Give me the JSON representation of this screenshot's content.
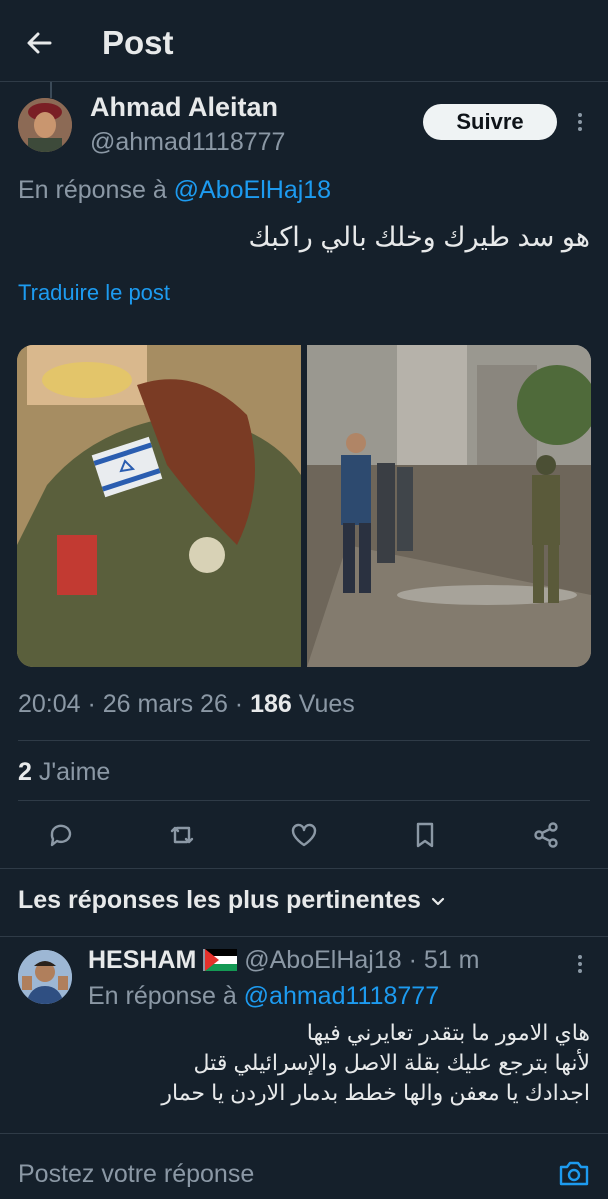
{
  "header": {
    "title": "Post"
  },
  "post": {
    "author_name": "Ahmad Aleitan",
    "author_handle": "@ahmad1118777",
    "follow_label": "Suivre",
    "reply_prefix": "En réponse à",
    "reply_to": "@AboElHaj18",
    "text": "هو سد طيرك وخلك بالي راكبك",
    "translate_label": "Traduire le post",
    "time": "20:04",
    "date": "26 mars 26",
    "views_count": "186",
    "views_label": "Vues",
    "likes_count": "2",
    "likes_label": "J'aime"
  },
  "actions": [
    "reply",
    "repost",
    "like",
    "bookmark",
    "share"
  ],
  "replies_section": {
    "label": "Les réponses les plus pertinentes"
  },
  "reply": {
    "name": "HESHAM",
    "flag": "palestine-flag",
    "handle": "@AboElHaj18",
    "time": "51 m",
    "reply_prefix": "En réponse à",
    "reply_to": "@ahmad1118777",
    "lines": [
      "هاي الامور ما بتقدر تعايرني فيها",
      "لأنها بترجع عليك بقلة الاصل والإسرائيلي قتل",
      "اجدادك يا معفن والها خطط بدمار الاردن يا حمار"
    ]
  },
  "compose": {
    "placeholder": "Postez votre réponse"
  },
  "colors": {
    "background": "#15202b",
    "accent": "#1d9bf0",
    "muted": "#8b98a5",
    "text": "#e7e9ea"
  }
}
